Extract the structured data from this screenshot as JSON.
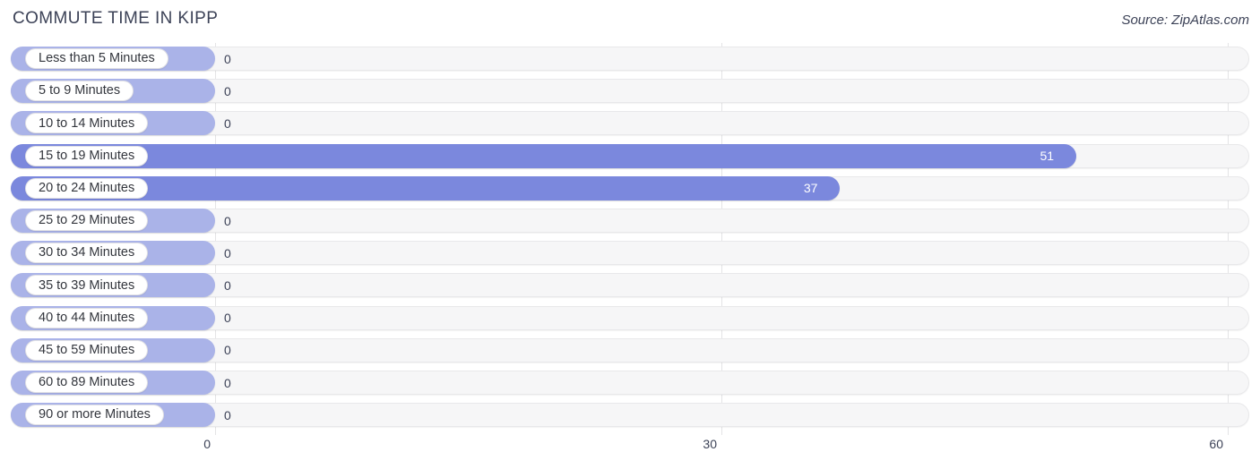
{
  "header": {
    "title": "COMMUTE TIME IN KIPP",
    "source": "Source: ZipAtlas.com"
  },
  "colors": {
    "bar_zero": "#aab3e8",
    "bar_filled": "#7b88dd",
    "track": "#f6f6f7",
    "gridline": "#e4e4e6",
    "text": "#3c4257"
  },
  "axis": {
    "ticks": [
      "0",
      "30",
      "60"
    ],
    "min": 0,
    "max": 60
  },
  "chart_data": {
    "type": "bar",
    "orientation": "horizontal",
    "title": "COMMUTE TIME IN KIPP",
    "xlabel": "",
    "ylabel": "",
    "xlim": [
      0,
      60
    ],
    "xticks": [
      0,
      30,
      60
    ],
    "grid": true,
    "legend": false,
    "source": "Source: ZipAtlas.com",
    "categories": [
      "Less than 5 Minutes",
      "5 to 9 Minutes",
      "10 to 14 Minutes",
      "15 to 19 Minutes",
      "20 to 24 Minutes",
      "25 to 29 Minutes",
      "30 to 34 Minutes",
      "35 to 39 Minutes",
      "40 to 44 Minutes",
      "45 to 59 Minutes",
      "60 to 89 Minutes",
      "90 or more Minutes"
    ],
    "values": [
      0,
      0,
      0,
      51,
      37,
      0,
      0,
      0,
      0,
      0,
      0,
      0
    ],
    "value_labels": [
      "0",
      "0",
      "0",
      "51",
      "37",
      "0",
      "0",
      "0",
      "0",
      "0",
      "0",
      "0"
    ]
  }
}
